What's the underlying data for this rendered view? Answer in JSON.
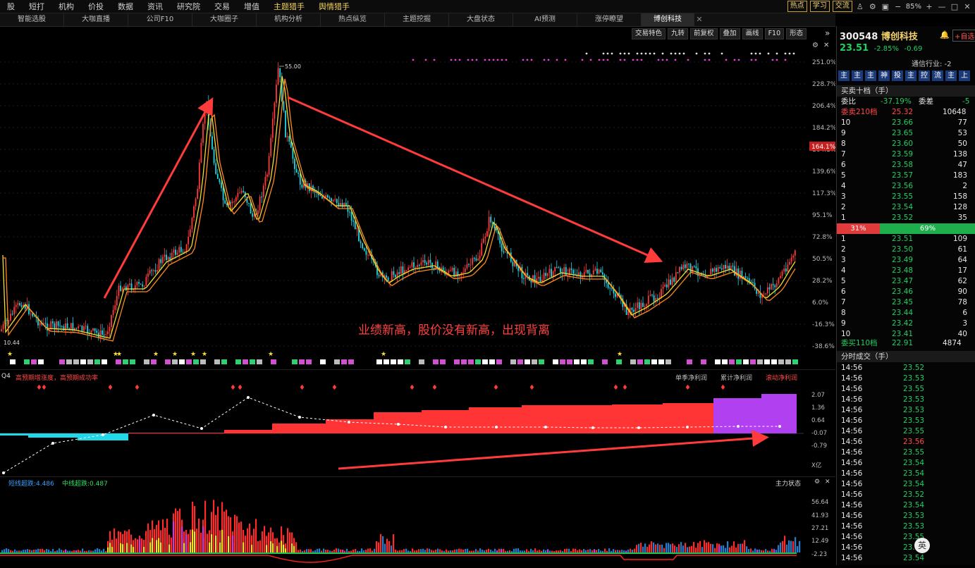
{
  "menu": {
    "items": [
      "股",
      "短打",
      "机构",
      "价投",
      "数据",
      "资讯",
      "研究院",
      "交易",
      "增值",
      "主题猎手",
      "舆情猎手"
    ],
    "right_buttons": [
      "热点",
      "学习",
      "交流"
    ],
    "zoom": "85%"
  },
  "tabs": {
    "items": [
      "智能选股",
      "大咖直播",
      "公司F10",
      "大咖圈子",
      "机构分析",
      "热点纵览",
      "主题挖掘",
      "大盘状态",
      "AI预测",
      "涨停瞭望"
    ],
    "active": "博创科技"
  },
  "chart_toolbar": [
    "交易特色",
    "九转",
    "前复权",
    "叠加",
    "画线",
    "F10",
    "形态"
  ],
  "main_chart": {
    "y_ticks": [
      "251.0%",
      "228.7%",
      "206.4%",
      "184.2%",
      "164.1%",
      "139.6%",
      "117.3%",
      "95.1%",
      "72.8%",
      "50.5%",
      "28.2%",
      "6.0%",
      "-16.3%",
      "-38.6%"
    ],
    "current_tag": "164.1%",
    "high_label": "55.00",
    "low_label": "10.44",
    "annotation": "业绩新高，股价没有新高，出现背离",
    "colors": {
      "up": "#ff3a3a",
      "down": "#1fd6e6",
      "ma1": "#f2e02c",
      "ma2": "#ff8a1a",
      "arrow": "#ff3b3b"
    }
  },
  "sub_chart": {
    "left_label": "Q4",
    "subtitle": "高预期增涨度，高预期成功率",
    "legend": [
      "单季净利润",
      "累计净利润",
      "滚动净利润"
    ],
    "y_ticks": [
      "2.07",
      "1.36",
      "0.64",
      "-0.07",
      "-0.79",
      "X亿"
    ]
  },
  "vol_chart": {
    "legend_short": "短线超跌:4.486",
    "legend_mid": "中线超跌:0.487",
    "title": "主力状态",
    "y_ticks": [
      "56.64",
      "41.93",
      "27.21",
      "12.49",
      "-2.23"
    ]
  },
  "stock": {
    "code": "300548",
    "name": "博创科技",
    "price": "23.51",
    "change_pct": "-2.85%",
    "change": "-0.69",
    "industry": "通信行业: -2",
    "fund_buttons": [
      "主",
      "主",
      "主",
      "神",
      "投",
      "主",
      "控",
      "流",
      "主",
      "上"
    ],
    "orderbook_title": "买卖十档（手）",
    "weibi_label": "委比",
    "weibi": "-37.19%",
    "weicha_label": "委差",
    "weicha": "-5",
    "sell_total_label": "委卖210档",
    "sell_total_price": "25.32",
    "sell_total_vol": "10648",
    "asks": [
      {
        "lvl": "10",
        "price": "23.66",
        "vol": "77"
      },
      {
        "lvl": "9",
        "price": "23.65",
        "vol": "53"
      },
      {
        "lvl": "8",
        "price": "23.60",
        "vol": "50"
      },
      {
        "lvl": "7",
        "price": "23.59",
        "vol": "138"
      },
      {
        "lvl": "6",
        "price": "23.58",
        "vol": "47"
      },
      {
        "lvl": "5",
        "price": "23.57",
        "vol": "183"
      },
      {
        "lvl": "4",
        "price": "23.56",
        "vol": "2"
      },
      {
        "lvl": "3",
        "price": "23.55",
        "vol": "158"
      },
      {
        "lvl": "2",
        "price": "23.54",
        "vol": "128"
      },
      {
        "lvl": "1",
        "price": "23.52",
        "vol": "35"
      }
    ],
    "ratio_sell": "31%",
    "ratio_buy": "69%",
    "ratio_sell_frac": 0.31,
    "bids": [
      {
        "lvl": "1",
        "price": "23.51",
        "vol": "109"
      },
      {
        "lvl": "2",
        "price": "23.50",
        "vol": "61"
      },
      {
        "lvl": "3",
        "price": "23.49",
        "vol": "64"
      },
      {
        "lvl": "4",
        "price": "23.48",
        "vol": "17"
      },
      {
        "lvl": "5",
        "price": "23.47",
        "vol": "62"
      },
      {
        "lvl": "6",
        "price": "23.46",
        "vol": "90"
      },
      {
        "lvl": "7",
        "price": "23.45",
        "vol": "78"
      },
      {
        "lvl": "8",
        "price": "23.44",
        "vol": "6"
      },
      {
        "lvl": "9",
        "price": "23.42",
        "vol": "3"
      },
      {
        "lvl": "10",
        "price": "23.41",
        "vol": "40"
      }
    ],
    "buy_total_label": "委买110档",
    "buy_total_price": "22.91",
    "buy_total_vol": "4874",
    "ticks_title": "分时成交（手）",
    "ticks": [
      {
        "t": "14:56",
        "p": "23.52",
        "c": "g"
      },
      {
        "t": "14:56",
        "p": "23.53",
        "c": "g"
      },
      {
        "t": "14:56",
        "p": "23.55",
        "c": "g"
      },
      {
        "t": "14:56",
        "p": "23.53",
        "c": "g"
      },
      {
        "t": "14:56",
        "p": "23.53",
        "c": "g"
      },
      {
        "t": "14:56",
        "p": "23.53",
        "c": "g"
      },
      {
        "t": "14:56",
        "p": "23.55",
        "c": "g"
      },
      {
        "t": "14:56",
        "p": "23.56",
        "c": "r"
      },
      {
        "t": "14:56",
        "p": "23.55",
        "c": "g"
      },
      {
        "t": "14:56",
        "p": "23.54",
        "c": "g"
      },
      {
        "t": "14:56",
        "p": "23.54",
        "c": "g"
      },
      {
        "t": "14:56",
        "p": "23.54",
        "c": "g"
      },
      {
        "t": "14:56",
        "p": "23.52",
        "c": "g"
      },
      {
        "t": "14:56",
        "p": "23.54",
        "c": "g"
      },
      {
        "t": "14:56",
        "p": "23.53",
        "c": "g"
      },
      {
        "t": "14:56",
        "p": "23.53",
        "c": "g"
      },
      {
        "t": "14:56",
        "p": "23.55",
        "c": "g"
      },
      {
        "t": "14:56",
        "p": "23.54",
        "c": "g"
      },
      {
        "t": "14:56",
        "p": "23.54",
        "c": "g"
      }
    ]
  },
  "ime_badge": "英"
}
